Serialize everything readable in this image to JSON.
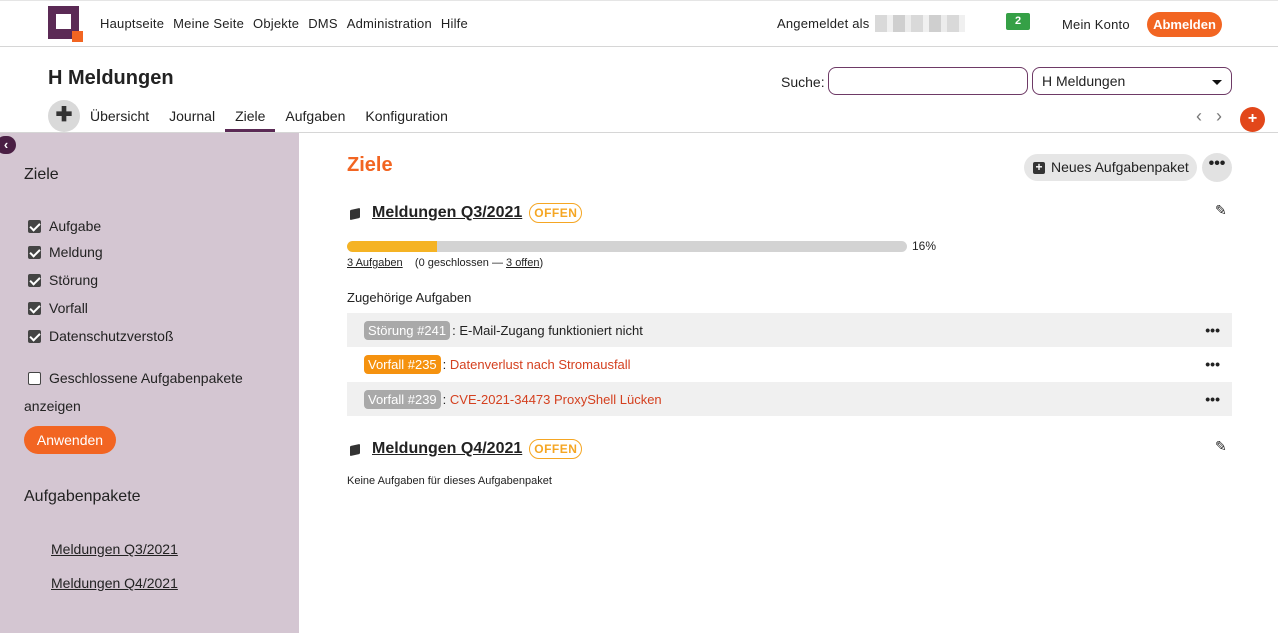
{
  "topbar": {
    "nav": [
      "Hauptseite",
      "Meine Seite",
      "Objekte",
      "DMS",
      "Administration",
      "Hilfe"
    ],
    "logged_in_label": "Angemeldet als",
    "notification_count": "2",
    "account_label": "Mein Konto",
    "logout_label": "Abmelden"
  },
  "project": {
    "title": "H Meldungen",
    "search_label": "Suche:",
    "search_value": "",
    "project_select": "H Meldungen"
  },
  "tabs": [
    "Übersicht",
    "Journal",
    "Ziele",
    "Aufgaben",
    "Konfiguration"
  ],
  "active_tab": "Ziele",
  "sidebar": {
    "title": "Ziele",
    "filters": [
      {
        "label": "Aufgabe",
        "checked": true
      },
      {
        "label": "Meldung",
        "checked": true
      },
      {
        "label": "Störung",
        "checked": true
      },
      {
        "label": "Vorfall",
        "checked": true
      },
      {
        "label": "Datenschutzverstoß",
        "checked": true
      }
    ],
    "closed_label_1": "Geschlossene Aufgabenpakete",
    "closed_label_2": "anzeigen",
    "closed_checked": false,
    "apply_label": "Anwenden",
    "packages_title": "Aufgabenpakete",
    "packages": [
      "Meldungen Q3/2021",
      "Meldungen Q4/2021"
    ]
  },
  "main": {
    "title": "Ziele",
    "new_package_label": "Neues Aufgabenpaket",
    "more_label": "•••",
    "packages": [
      {
        "name": "Meldungen Q3/2021",
        "status": "OFFEN",
        "progress_percent": 16,
        "progress_label": "16%",
        "tasks_link": "3 Aufgaben",
        "closed_text": "(0 geschlossen —",
        "open_link": "3 offen",
        "close_paren": ")",
        "related_label": "Zugehörige Aufgaben",
        "tasks": [
          {
            "tag": "Störung #241",
            "tag_color": "#a9a9a9",
            "title": "E-Mail-Zugang funktioniert nicht",
            "title_color": "#222222",
            "shaded": true
          },
          {
            "tag": "Vorfall #235",
            "tag_color": "#f5920f",
            "title": "Datenverlust nach Stromausfall",
            "title_color": "#d4401f",
            "shaded": false
          },
          {
            "tag": "Vorfall #239",
            "tag_color": "#a9a9a9",
            "title": "CVE-2021-34473 ProxyShell Lücken",
            "title_color": "#d4401f",
            "shaded": true
          }
        ]
      },
      {
        "name": "Meldungen Q4/2021",
        "status": "OFFEN",
        "empty_text": "Keine Aufgaben für dieses Aufgabenpaket"
      }
    ]
  },
  "colors": {
    "brand": "#5b2a55",
    "accent": "#f26522",
    "status_open": "#f5a623",
    "progress_fill": "#f5b324",
    "notification": "#35a046"
  },
  "icons": [
    "logo-icon",
    "plus-icon",
    "chevron-left-icon",
    "chevron-right-icon",
    "add-icon",
    "collapse-icon",
    "package-icon",
    "pencil-icon",
    "more-icon"
  ]
}
